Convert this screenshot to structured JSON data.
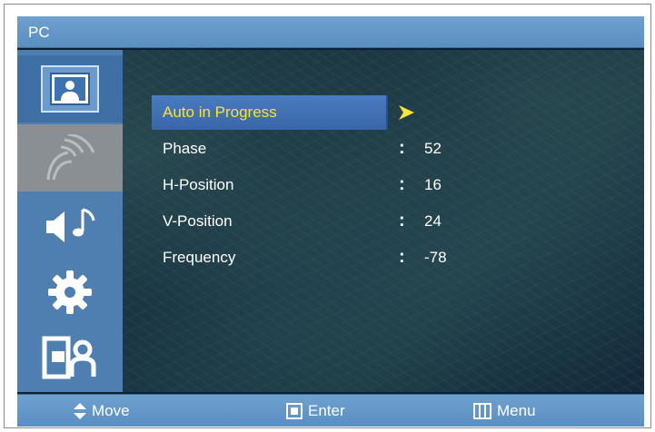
{
  "title": "PC",
  "sidebar": {
    "items": [
      {
        "icon": "picture-icon",
        "state": "active"
      },
      {
        "icon": "antenna-icon",
        "state": "disabled"
      },
      {
        "icon": "sound-icon",
        "state": "normal"
      },
      {
        "icon": "gear-icon",
        "state": "normal"
      },
      {
        "icon": "input-icon",
        "state": "normal"
      }
    ]
  },
  "menu": {
    "rows": [
      {
        "label": "Auto in Progress",
        "value": "",
        "selected": true
      },
      {
        "label": "Phase",
        "value": "52"
      },
      {
        "label": "H-Position",
        "value": "16"
      },
      {
        "label": "V-Position",
        "value": "24"
      },
      {
        "label": "Frequency",
        "value": "-78"
      }
    ]
  },
  "footer": {
    "move": "Move",
    "enter": "Enter",
    "menu": "Menu"
  },
  "colors": {
    "bar": "#5b8ec1",
    "highlight_text": "#f7e33a",
    "background": "#16303d"
  }
}
